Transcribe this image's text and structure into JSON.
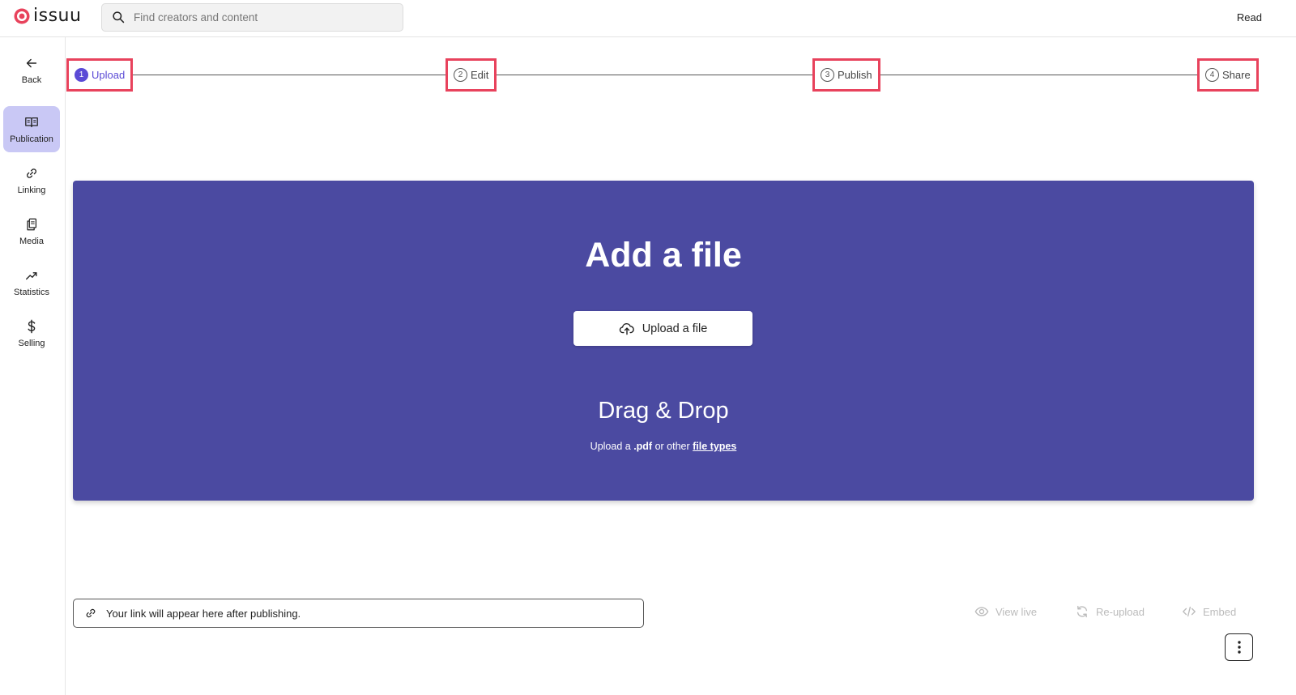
{
  "header": {
    "brand": "issuu",
    "search_placeholder": "Find creators and content",
    "read_label": "Read"
  },
  "sidebar": {
    "back_label": "Back",
    "items": [
      {
        "label": "Publication",
        "icon": "book-icon",
        "active": true
      },
      {
        "label": "Linking",
        "icon": "link-icon",
        "active": false
      },
      {
        "label": "Media",
        "icon": "pages-icon",
        "active": false
      },
      {
        "label": "Statistics",
        "icon": "trend-icon",
        "active": false
      },
      {
        "label": "Selling",
        "icon": "dollar-icon",
        "active": false
      }
    ]
  },
  "stepper": {
    "steps": [
      {
        "number": "1",
        "label": "Upload",
        "current": true
      },
      {
        "number": "2",
        "label": "Edit",
        "current": false
      },
      {
        "number": "3",
        "label": "Publish",
        "current": false
      },
      {
        "number": "4",
        "label": "Share",
        "current": false
      }
    ]
  },
  "dropzone": {
    "title": "Add a file",
    "button_label": "Upload a file",
    "subtitle": "Drag & Drop",
    "hint_prefix": "Upload a ",
    "hint_ext": ".pdf",
    "hint_middle": " or other ",
    "hint_link": "file types"
  },
  "footer": {
    "link_placeholder": "Your link will appear here after publishing.",
    "actions": {
      "view_live": "View live",
      "reupload": "Re-upload",
      "embed": "Embed"
    }
  },
  "colors": {
    "brand_red": "#e8425c",
    "accent": "#5b4bd6",
    "dropzone_bg": "#4b4aa1",
    "active_nav": "#c9c8f5"
  }
}
